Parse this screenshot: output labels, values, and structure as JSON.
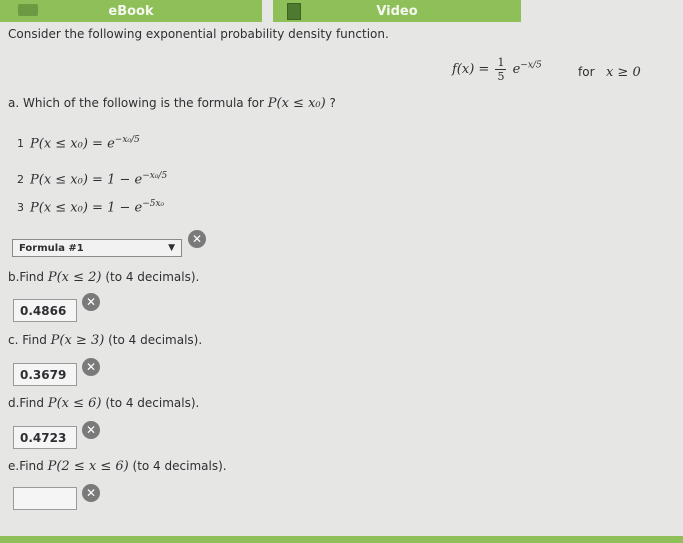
{
  "toolbar": {
    "ebook_label": "eBook",
    "video_label": "Video"
  },
  "intro": "Consider the following exponential probability density function.",
  "pdf": {
    "lhs": "f(x) =",
    "num": "1",
    "den": "5",
    "base": "e",
    "exp": "−x/5",
    "for": "for",
    "domain": "x ≥ 0"
  },
  "part_a": {
    "prefix": "a. Which of the following is the formula for ",
    "expr": "P(x ≤ x₀)",
    "suffix": " ?",
    "options": [
      {
        "num": "1",
        "lhs": "P(x ≤ x₀) = e",
        "exp": "−x₀/5"
      },
      {
        "num": "2",
        "lhs": "P(x ≤ x₀) = 1 − e",
        "exp": "−x₀/5"
      },
      {
        "num": "3",
        "lhs": "P(x ≤ x₀) = 1 − e",
        "exp": "−5x₀"
      }
    ],
    "selected": "Formula #1"
  },
  "part_b": {
    "prefix": "b.Find ",
    "expr": "P(x ≤ 2)",
    "suffix": " (to 4 decimals).",
    "answer": "0.4866"
  },
  "part_c": {
    "prefix": "c. Find ",
    "expr": "P(x ≥ 3)",
    "suffix": " (to 4 decimals).",
    "answer": "0.3679"
  },
  "part_d": {
    "prefix": "d.Find ",
    "expr": "P(x ≤ 6)",
    "suffix": " (to 4 decimals).",
    "answer": "0.4723"
  },
  "part_e": {
    "prefix": "e.Find ",
    "expr": "P(2 ≤ x ≤ 6)",
    "suffix": " (to 4 decimals).",
    "answer": ""
  },
  "icons": {
    "incorrect": "x-circle-icon",
    "close_glyph": "✕"
  }
}
